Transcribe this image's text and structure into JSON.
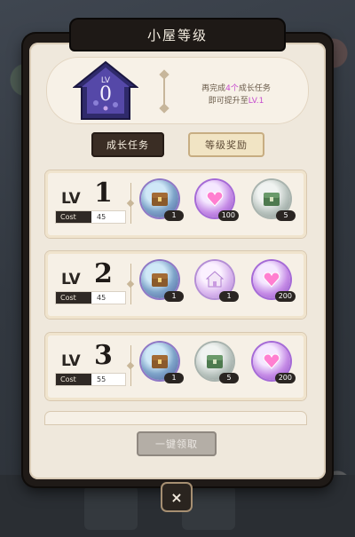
{
  "title": "小屋等级",
  "header": {
    "level_prefix": "LV",
    "level_value": "0",
    "line1_before": "再完成",
    "line1_highlight": "4个",
    "line1_after": "成长任务",
    "line2_before": "即可提升至",
    "line2_highlight": "LV.1"
  },
  "tabs": {
    "growth": "成长任务",
    "rewards": "等级奖励"
  },
  "rows": [
    {
      "lv_label": "LV",
      "lv_num": "1",
      "cost_label": "Cost",
      "cost_value": "45",
      "rewards": [
        {
          "icon": "treasure-chest-icon",
          "count": "1"
        },
        {
          "icon": "heart-gem-icon",
          "count": "100"
        },
        {
          "icon": "green-chest-icon",
          "count": "5"
        }
      ]
    },
    {
      "lv_label": "LV",
      "lv_num": "2",
      "cost_label": "Cost",
      "cost_value": "45",
      "rewards": [
        {
          "icon": "treasure-chest-icon",
          "count": "1"
        },
        {
          "icon": "house-icon",
          "count": "1"
        },
        {
          "icon": "heart-gem-icon",
          "count": "200"
        }
      ]
    },
    {
      "lv_label": "LV",
      "lv_num": "3",
      "cost_label": "Cost",
      "cost_value": "55",
      "rewards": [
        {
          "icon": "treasure-chest-icon",
          "count": "1"
        },
        {
          "icon": "green-chest-icon",
          "count": "5"
        },
        {
          "icon": "heart-gem-icon",
          "count": "200"
        }
      ]
    }
  ],
  "claim_all": "一键领取",
  "close": "×",
  "colors": {
    "accent": "#c64ccf",
    "panel": "#efe8dc",
    "dark": "#1f1a17"
  }
}
